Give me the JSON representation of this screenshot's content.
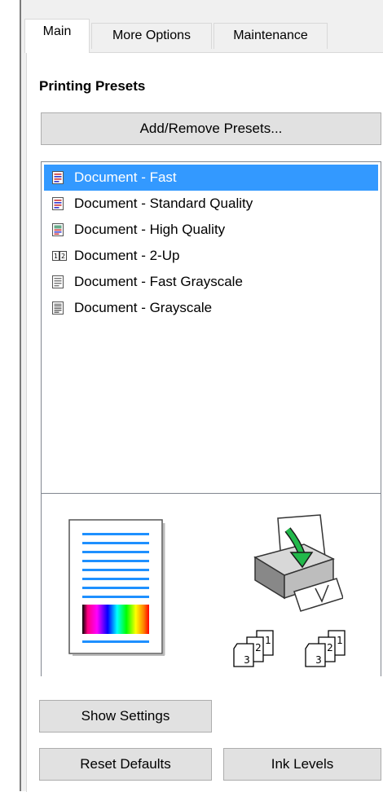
{
  "tabs": [
    {
      "label": "Main",
      "active": true
    },
    {
      "label": "More Options",
      "active": false
    },
    {
      "label": "Maintenance",
      "active": false
    }
  ],
  "presets": {
    "section_title": "Printing Presets",
    "add_remove_label": "Add/Remove Presets...",
    "items": [
      {
        "label": "Document - Fast",
        "icon": "color-document-icon",
        "selected": true
      },
      {
        "label": "Document - Standard Quality",
        "icon": "color-document-icon",
        "selected": false
      },
      {
        "label": "Document - High Quality",
        "icon": "high-quality-document-icon",
        "selected": false
      },
      {
        "label": "Document - 2-Up",
        "icon": "two-up-icon",
        "selected": false
      },
      {
        "label": "Document - Fast Grayscale",
        "icon": "grayscale-document-icon",
        "selected": false
      },
      {
        "label": "Document - Grayscale",
        "icon": "grayscale-document-icon",
        "selected": false
      }
    ]
  },
  "preview": {
    "page_icon": "page-preview-icon",
    "printer_icon": "printer-icon",
    "collate_icons": [
      "collate-pages-icon",
      "collate-pages-icon"
    ],
    "collate_numbers": [
      "1",
      "2",
      "3"
    ]
  },
  "buttons": {
    "show_settings": "Show Settings",
    "reset_defaults": "Reset Defaults",
    "ink_levels": "Ink Levels"
  },
  "colors": {
    "selection": "#3399ff",
    "panel_bg": "#f0f0f0",
    "button_bg": "#e1e1e1",
    "line_blue": "#1e90ff"
  }
}
